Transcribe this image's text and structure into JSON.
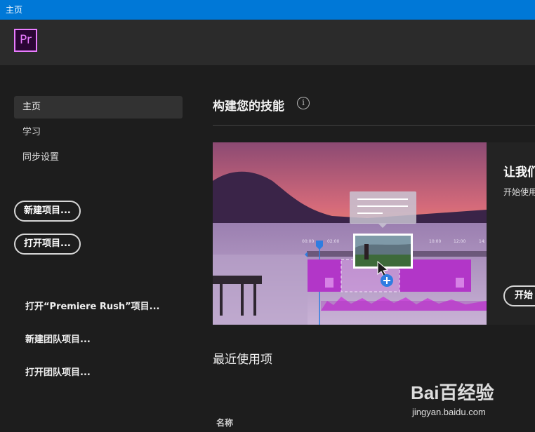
{
  "window": {
    "title": "主页"
  },
  "app": {
    "logo_text": "Pr",
    "accent": "#e97cff"
  },
  "sidebar": {
    "nav": [
      {
        "label": "主页",
        "active": true
      },
      {
        "label": "学习",
        "active": false
      },
      {
        "label": "同步设置",
        "active": false
      }
    ],
    "buttons": {
      "new_project": "新建项目...",
      "open_project": "打开项目..."
    },
    "links": {
      "open_rush": "打开“Premiere Rush”项目...",
      "new_team": "新建团队项目...",
      "open_team": "打开团队项目..."
    }
  },
  "main": {
    "section_title": "构建您的技能",
    "hero": {
      "title": "让我们",
      "subtitle": "开始使用",
      "button": "开始",
      "timecodes": [
        "00:00",
        "02:00",
        "10:00",
        "12:00",
        "14:"
      ]
    },
    "recent": {
      "title": "最近使用项",
      "name_column": "名称"
    }
  },
  "watermark": {
    "brand": "Bai百经验",
    "domain": "jingyan.baidu.com"
  }
}
